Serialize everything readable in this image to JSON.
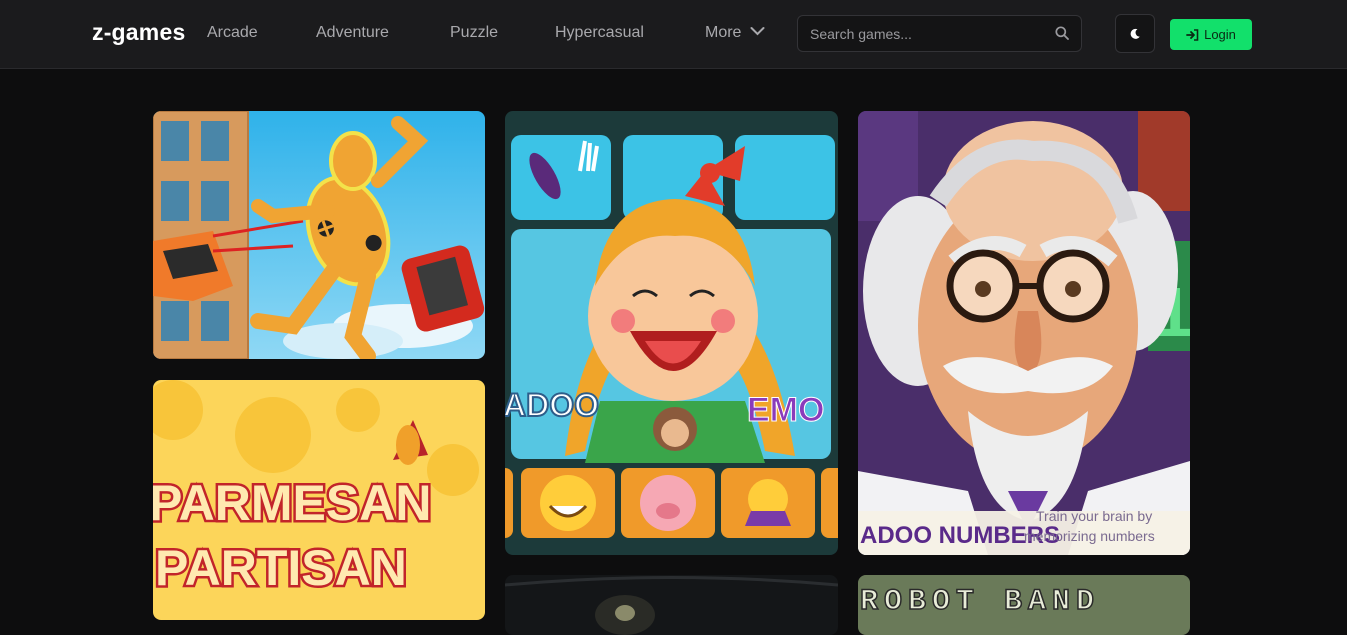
{
  "header": {
    "logo": "z-games",
    "nav": [
      "Arcade",
      "Adventure",
      "Puzzle",
      "Hypercasual"
    ],
    "more_label": "More",
    "search_placeholder": "Search games...",
    "login_label": "Login"
  },
  "games": {
    "card2_text_left": "ADOO",
    "card2_text_right": "EMO",
    "card3_title": "ADOO NUMBERS",
    "card3_tagline_1": "Train your brain by",
    "card3_tagline_2": "memorizing numbers",
    "card4_title_1": "PARMESAN",
    "card4_title_2": "PARTISAN",
    "card6_title": "ROBOT BAND"
  },
  "colors": {
    "accent": "#12e06b",
    "background": "#0d0d0e",
    "header": "#1b1b1d"
  }
}
